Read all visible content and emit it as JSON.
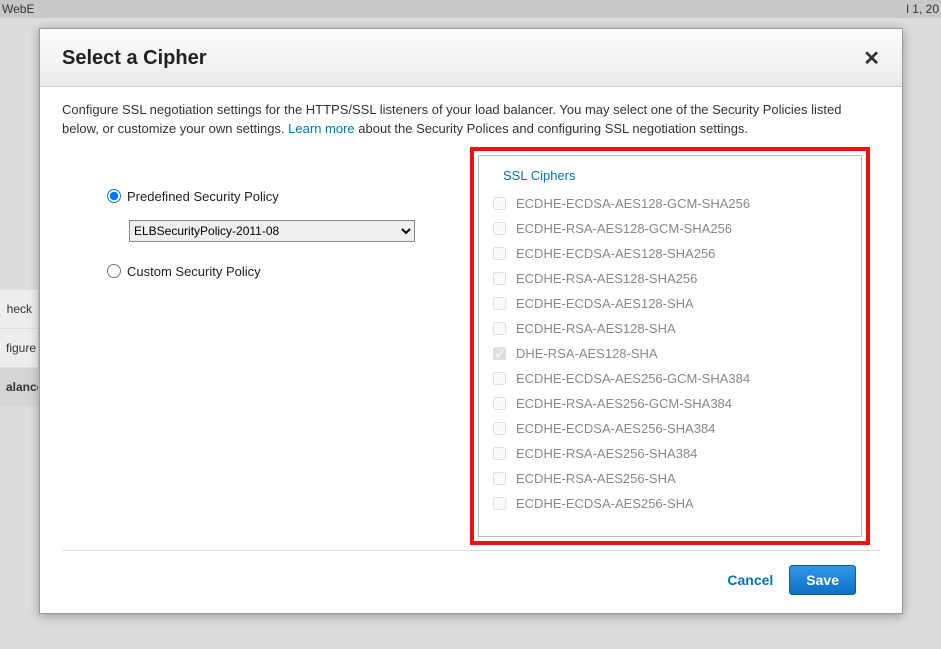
{
  "bg": {
    "topLeft": "WebE",
    "topRight": "l 1, 20",
    "sideItems": [
      "heck",
      "figure",
      "alance"
    ],
    "sideActive": 2
  },
  "modal": {
    "title": "Select a Cipher",
    "intro_part1": "Configure SSL negotiation settings for the HTTPS/SSL listeners of your load balancer. You may select one of the Security Policies listed below, or customize your own settings. ",
    "learn_more": "Learn more",
    "intro_part2": " about the Security Polices and configuring SSL negotiation settings.",
    "radio_predefined": "Predefined Security Policy",
    "radio_custom": "Custom Security Policy",
    "selected_policy": "ELBSecurityPolicy-2011-08",
    "cipher_header": "SSL Ciphers",
    "ciphers": [
      {
        "name": "ECDHE-ECDSA-AES128-GCM-SHA256",
        "checked": false
      },
      {
        "name": "ECDHE-RSA-AES128-GCM-SHA256",
        "checked": false
      },
      {
        "name": "ECDHE-ECDSA-AES128-SHA256",
        "checked": false
      },
      {
        "name": "ECDHE-RSA-AES128-SHA256",
        "checked": false
      },
      {
        "name": "ECDHE-ECDSA-AES128-SHA",
        "checked": false
      },
      {
        "name": "ECDHE-RSA-AES128-SHA",
        "checked": false
      },
      {
        "name": "DHE-RSA-AES128-SHA",
        "checked": true
      },
      {
        "name": "ECDHE-ECDSA-AES256-GCM-SHA384",
        "checked": false
      },
      {
        "name": "ECDHE-RSA-AES256-GCM-SHA384",
        "checked": false
      },
      {
        "name": "ECDHE-ECDSA-AES256-SHA384",
        "checked": false
      },
      {
        "name": "ECDHE-RSA-AES256-SHA384",
        "checked": false
      },
      {
        "name": "ECDHE-RSA-AES256-SHA",
        "checked": false
      },
      {
        "name": "ECDHE-ECDSA-AES256-SHA",
        "checked": false
      }
    ],
    "cancel": "Cancel",
    "save": "Save"
  }
}
